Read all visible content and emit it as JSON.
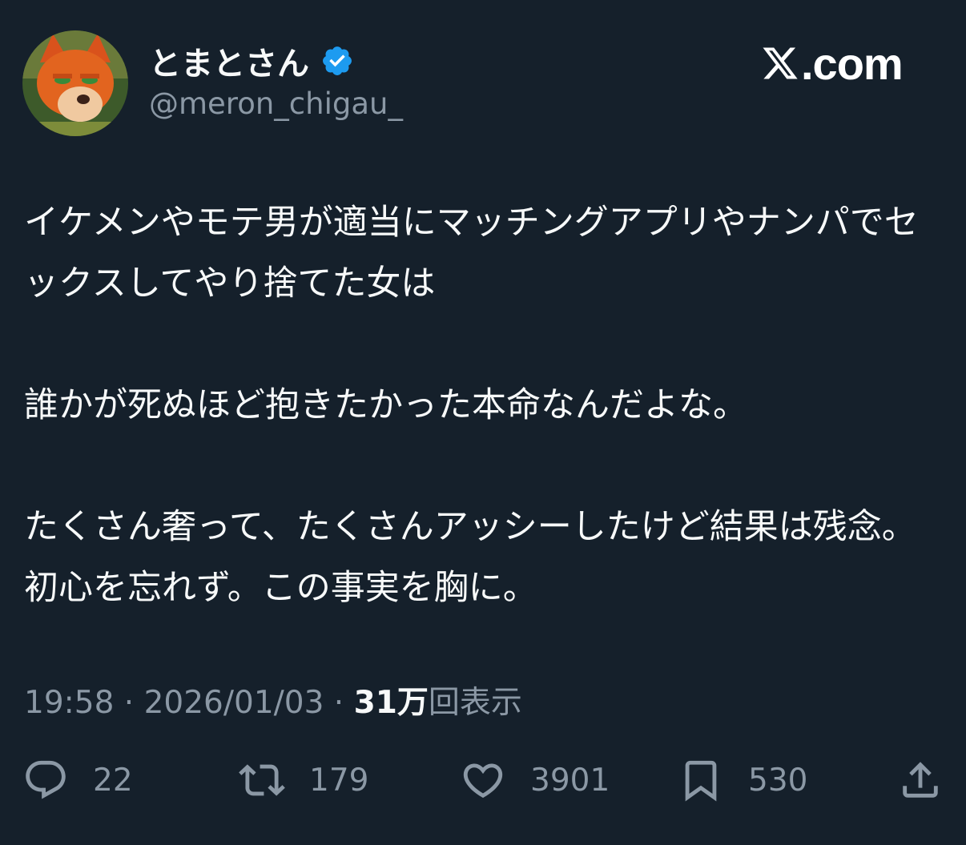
{
  "author": {
    "display_name": "とまとさん",
    "handle": "@meron_chigau_",
    "verified_icon": "verified-badge-icon",
    "avatar": "fox-character-avatar"
  },
  "brand": {
    "label": ".com",
    "icon": "x-logo-icon"
  },
  "tweet": {
    "paragraphs": [
      "イケメンやモテ男が適当にマッチングアプリやナンパでセックスしてやり捨てた女は",
      "誰かが死ぬほど抱きたかった本命なんだよな。",
      "たくさん奢って、たくさんアッシーしたけど結果は残念。 初心を忘れず。この事実を胸に。"
    ]
  },
  "meta": {
    "time": "19:58",
    "separator": " · ",
    "date": "2026/01/03",
    "views_count": "31万",
    "views_label": "回表示"
  },
  "actions": {
    "reply": {
      "count": "22",
      "icon": "reply-bubble-icon"
    },
    "repost": {
      "count": "179",
      "icon": "repost-arrows-icon"
    },
    "like": {
      "count": "3901",
      "icon": "heart-icon"
    },
    "bookmark": {
      "count": "530",
      "icon": "bookmark-icon"
    },
    "share": {
      "icon": "share-upload-icon"
    }
  },
  "colors": {
    "background": "#15202b",
    "primary_text": "#f7f9f9",
    "secondary_text": "#8b98a5",
    "verified_blue": "#1d9bf0"
  }
}
